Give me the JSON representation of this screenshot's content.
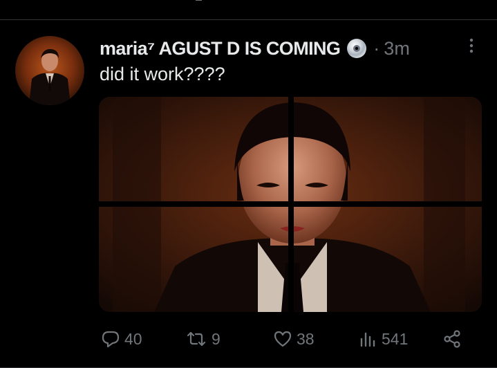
{
  "tweet": {
    "display_name": "maria⁷ AGUST D IS COMING",
    "separator": "·",
    "time": "3m",
    "text": "did it work????",
    "badge_icon": "disc-icon",
    "media_icon": "photo-grid-quartered"
  },
  "actions": {
    "reply_count": "40",
    "retweet_count": "9",
    "like_count": "38",
    "view_count": "541"
  },
  "colors": {
    "background": "#000000",
    "text_primary": "#e7e9ea",
    "text_secondary": "#71767b",
    "divider": "#2f3336"
  }
}
